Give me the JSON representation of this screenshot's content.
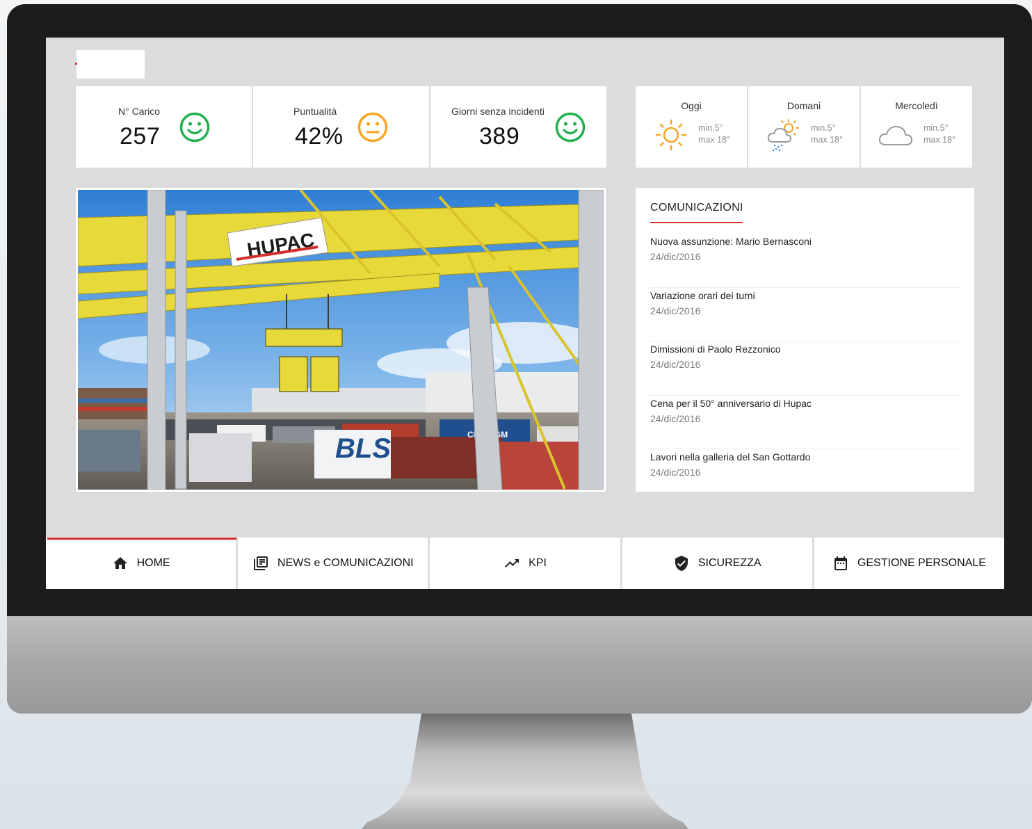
{
  "kpis": [
    {
      "label": "N° Carico",
      "value": "257",
      "status": "good",
      "color": "#22b14c"
    },
    {
      "label": "Puntualità",
      "value": "42%",
      "status": "neutral",
      "color": "#f5a623"
    },
    {
      "label": "Giorni senza incidenti",
      "value": "389",
      "status": "good",
      "color": "#22b14c"
    }
  ],
  "weather": [
    {
      "day": "Oggi",
      "min": "min.5°",
      "max": "max 18°",
      "icon": "sun-icon"
    },
    {
      "day": "Domani",
      "min": "min.5°",
      "max": "max 18°",
      "icon": "sun-rain-cloud-icon"
    },
    {
      "day": "Mercoledì",
      "min": "min.5°",
      "max": "max 18°",
      "icon": "cloud-icon"
    }
  ],
  "comms": {
    "title": "COMUNICAZIONI",
    "items": [
      {
        "title": "Nuova assunzione: Mario Bernasconi",
        "date": "24/dic/2016"
      },
      {
        "title": "Variazione orari dei turni",
        "date": "24/dic/2016"
      },
      {
        "title": "Dimissioni di Paolo Rezzonico",
        "date": "24/dic/2016"
      },
      {
        "title": "Cena per il 50° anniversario di Hupac",
        "date": "24/dic/2016"
      },
      {
        "title": "Lavori nella galleria del San Gottardo",
        "date": "24/dic/2016"
      }
    ]
  },
  "hero": {
    "sign_text": "HUPAC",
    "container_text_1": "CMA CGM",
    "container_text_2": "BLS"
  },
  "nav": [
    {
      "label": "HOME",
      "icon": "home-icon",
      "active": true
    },
    {
      "label": "NEWS e COMUNICAZIONI",
      "icon": "news-icon",
      "active": false
    },
    {
      "label": "KPI",
      "icon": "trending-up-icon",
      "active": false
    },
    {
      "label": "SICUREZZA",
      "icon": "shield-check-icon",
      "active": false
    },
    {
      "label": "GESTIONE PERSONALE",
      "icon": "calendar-icon",
      "active": false
    }
  ],
  "colors": {
    "accent": "#d32f2f",
    "good": "#22b14c",
    "warning": "#f5a623",
    "crane": "#e8d93a"
  }
}
